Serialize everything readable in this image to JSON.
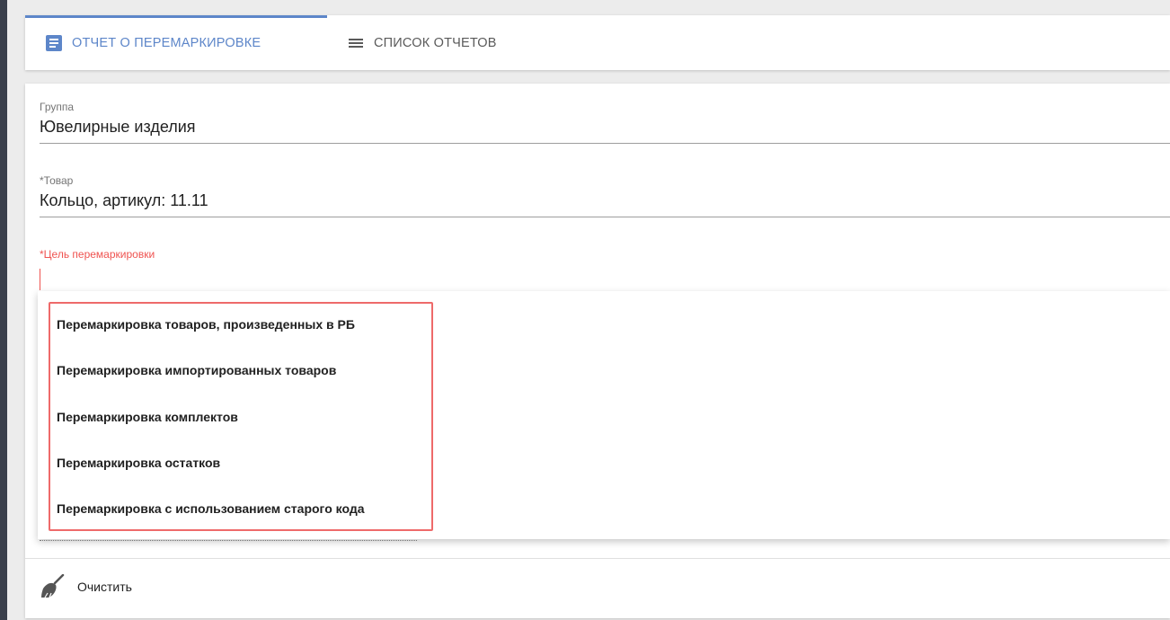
{
  "tabs": [
    {
      "label": "ОТЧЕТ О ПЕРЕМАРКИРОВКЕ",
      "icon": "document-icon",
      "active": true
    },
    {
      "label": "СПИСОК ОТЧЕТОВ",
      "icon": "list-icon",
      "active": false
    }
  ],
  "form": {
    "group": {
      "label": "Группа",
      "value": "Ювелирные изделия"
    },
    "product": {
      "label": "*Товар",
      "value": "Кольцо, артикул: 11.11"
    },
    "purpose": {
      "label": "*Цель перемаркировки",
      "value": ""
    }
  },
  "dropdown": {
    "options": [
      "Перемаркировка товаров, произведенных в РБ",
      "Перемаркировка импортированных товаров",
      "Перемаркировка комплектов",
      "Перемаркировка остатков",
      "Перемаркировка с использованием старого кода"
    ]
  },
  "footer": {
    "clear_label": "Очистить",
    "clear_icon": "broom-icon"
  },
  "colors": {
    "accent": "#5d86c9",
    "error": "#ef5350",
    "highlight": "#ee6a6a"
  }
}
